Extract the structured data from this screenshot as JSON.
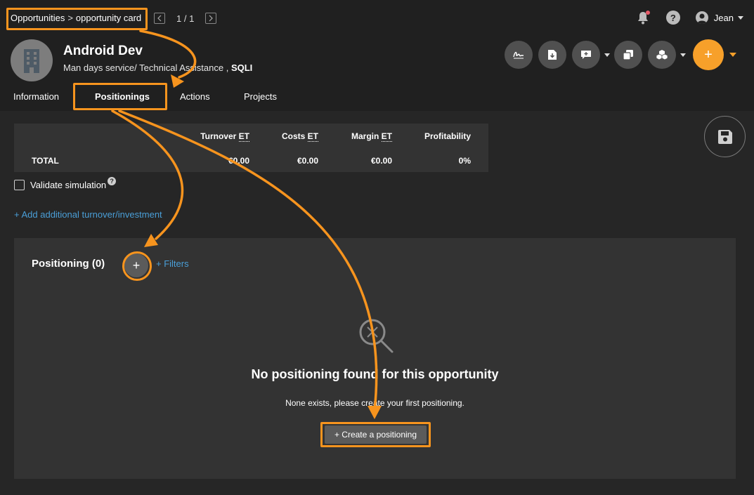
{
  "breadcrumb": {
    "parent": "Opportunities",
    "separator": ">",
    "current": "opportunity card"
  },
  "pager": {
    "count": "1 / 1"
  },
  "user": {
    "name": "Jean"
  },
  "help": {
    "label": "?"
  },
  "opportunity": {
    "title": "Android Dev",
    "subtitle_prefix": "Man days service/ Technical Assistance ,",
    "company": "SQLI"
  },
  "toolbar": {
    "add_label": "+"
  },
  "tabs": [
    {
      "label": "Information"
    },
    {
      "label": "Positionings"
    },
    {
      "label": "Actions"
    },
    {
      "label": "Projects"
    }
  ],
  "totals": {
    "headers": [
      "Turnover ET",
      "Costs ET",
      "Margin ET",
      "Profitability"
    ],
    "header_parts": [
      {
        "text": "Turnover ",
        "abbr": "ET"
      },
      {
        "text": "Costs ",
        "abbr": "ET"
      },
      {
        "text": "Margin ",
        "abbr": "ET"
      },
      {
        "text": "Profitability",
        "abbr": ""
      }
    ],
    "row_label": "TOTAL",
    "values": [
      "€0.00",
      "€0.00",
      "€0.00",
      "0%"
    ]
  },
  "validate": {
    "label": "Validate simulation",
    "help": "?"
  },
  "add_additional": {
    "label": "+ Add additional turnover/investment"
  },
  "positioning": {
    "title": "Positioning (0)",
    "add_label": "+",
    "filters_label": "+ Filters",
    "empty_title": "No positioning found for this opportunity",
    "empty_subtitle": "None exists, please create your first positioning.",
    "create_label": "+ Create a positioning"
  },
  "colors": {
    "accent": "#f7941e",
    "link": "#4a9fd8",
    "notification": "#e85c6a",
    "panel": "#333333",
    "header": "#202020"
  },
  "icons": [
    "building-icon",
    "bell-icon",
    "help-icon",
    "user-icon",
    "signature-icon",
    "document-download-icon",
    "comment-icon",
    "duplicate-icon",
    "cubes-icon",
    "save-icon",
    "search-empty-icon"
  ]
}
